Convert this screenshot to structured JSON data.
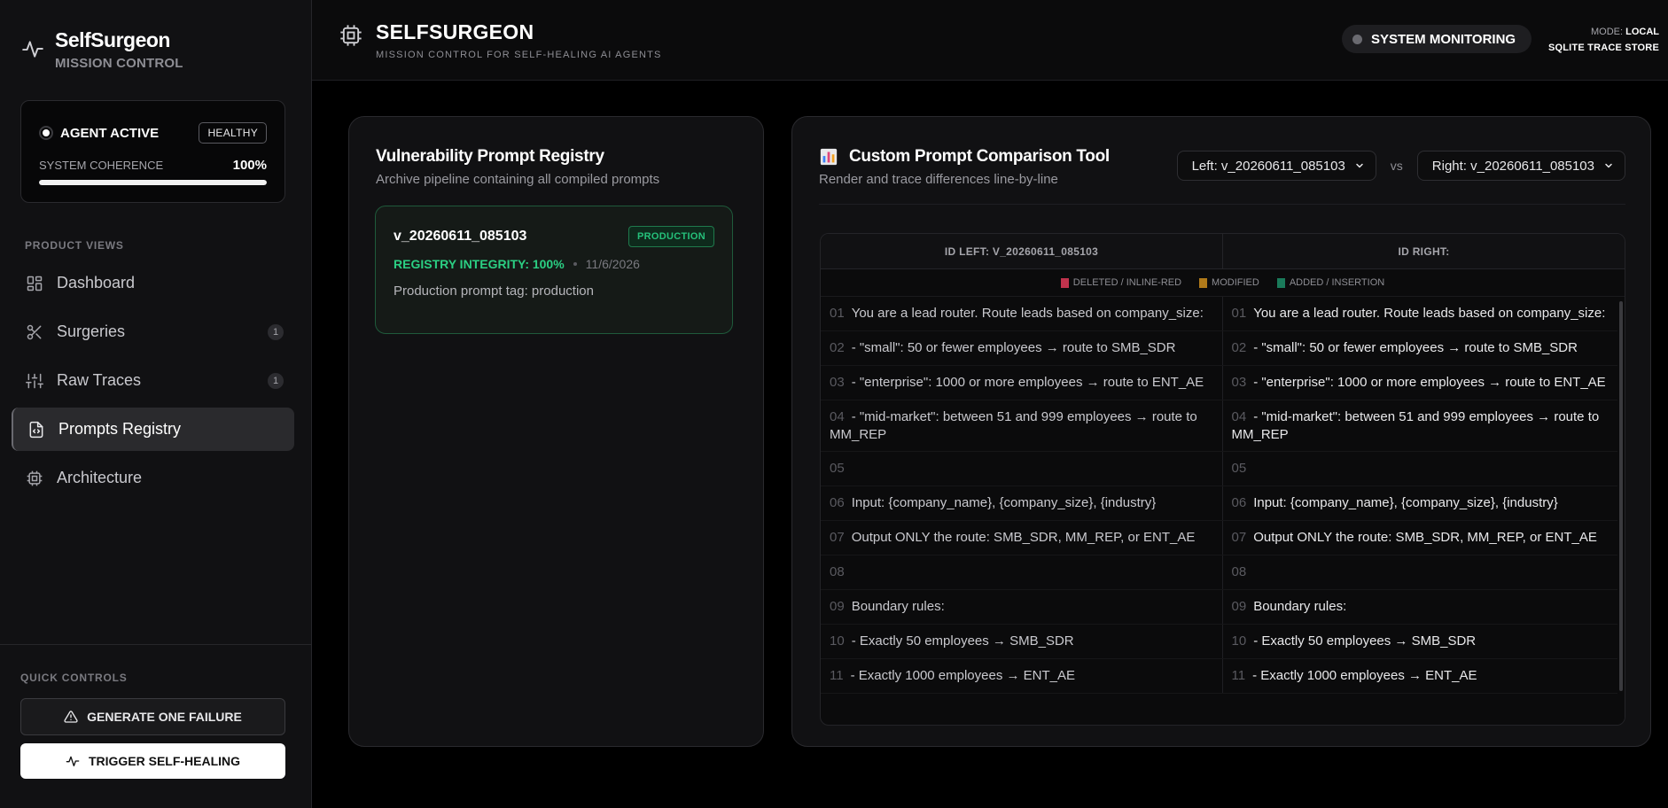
{
  "brand": {
    "title": "SelfSurgeon",
    "subtitle": "MISSION CONTROL"
  },
  "status": {
    "agent": "AGENT ACTIVE",
    "health": "HEALTHY",
    "coherence_label": "SYSTEM COHERENCE",
    "coherence_value": "100%",
    "coherence_fraction": 1.0
  },
  "nav": {
    "section_label": "PRODUCT VIEWS",
    "items": [
      {
        "label": "Dashboard",
        "icon": "dashboard-icon",
        "count": ""
      },
      {
        "label": "Surgeries",
        "icon": "scissors-icon",
        "count": "1"
      },
      {
        "label": "Raw Traces",
        "icon": "sliders-icon",
        "count": "1"
      },
      {
        "label": "Prompts Registry",
        "icon": "file-code-icon",
        "count": "",
        "active": true
      },
      {
        "label": "Architecture",
        "icon": "chip-icon",
        "count": ""
      }
    ]
  },
  "quick": {
    "label": "QUICK CONTROLS",
    "fail_button": "GENERATE ONE FAILURE",
    "heal_button": "TRIGGER SELF-HEALING"
  },
  "topbar": {
    "title": "SELFSURGEON",
    "subtitle": "MISSION CONTROL FOR SELF-HEALING AI AGENTS",
    "monitor": "SYSTEM MONITORING",
    "mode_label": "MODE:",
    "mode_value": "LOCAL",
    "store": "SQLITE TRACE STORE"
  },
  "registry": {
    "title": "Vulnerability Prompt Registry",
    "subtitle": "Archive pipeline containing all compiled prompts",
    "prompt": {
      "name": "v_20260611_085103",
      "badge": "PRODUCTION",
      "integrity": "REGISTRY INTEGRITY: 100%",
      "date": "11/6/2026",
      "description": "Production prompt tag: production"
    }
  },
  "comparison": {
    "title": "Custom Prompt Comparison Tool",
    "subtitle": "Render and trace differences line-by-line",
    "left_select": "Left: v_20260611_085103",
    "vs": "vs",
    "right_select": "Right: v_20260611_085103",
    "col_left": "ID LEFT: V_20260611_085103",
    "col_right": "ID RIGHT:",
    "legend": {
      "deleted": "DELETED / INLINE-RED",
      "modified": "MODIFIED",
      "added": "ADDED / INSERTION"
    },
    "colors": {
      "deleted": "#c0334d",
      "modified": "#b07a1a",
      "added": "#1a7a5a"
    },
    "lines": [
      {
        "n": "01",
        "text": "You are a lead router. Route leads based on company_size:"
      },
      {
        "n": "02",
        "text": "- \"small\": 50 or fewer employees → route to SMB_SDR"
      },
      {
        "n": "03",
        "text": "- \"enterprise\": 1000 or more employees → route to ENT_AE"
      },
      {
        "n": "04",
        "text": "- \"mid-market\": between 51 and 999 employees → route to MM_REP"
      },
      {
        "n": "05",
        "text": ""
      },
      {
        "n": "06",
        "text": "Input: {company_name}, {company_size}, {industry}"
      },
      {
        "n": "07",
        "text": "Output ONLY the route: SMB_SDR, MM_REP, or ENT_AE"
      },
      {
        "n": "08",
        "text": ""
      },
      {
        "n": "09",
        "text": "Boundary rules:"
      },
      {
        "n": "10",
        "text": "- Exactly 50 employees → SMB_SDR"
      },
      {
        "n": "11",
        "text": "- Exactly 1000 employees → ENT_AE"
      }
    ]
  }
}
